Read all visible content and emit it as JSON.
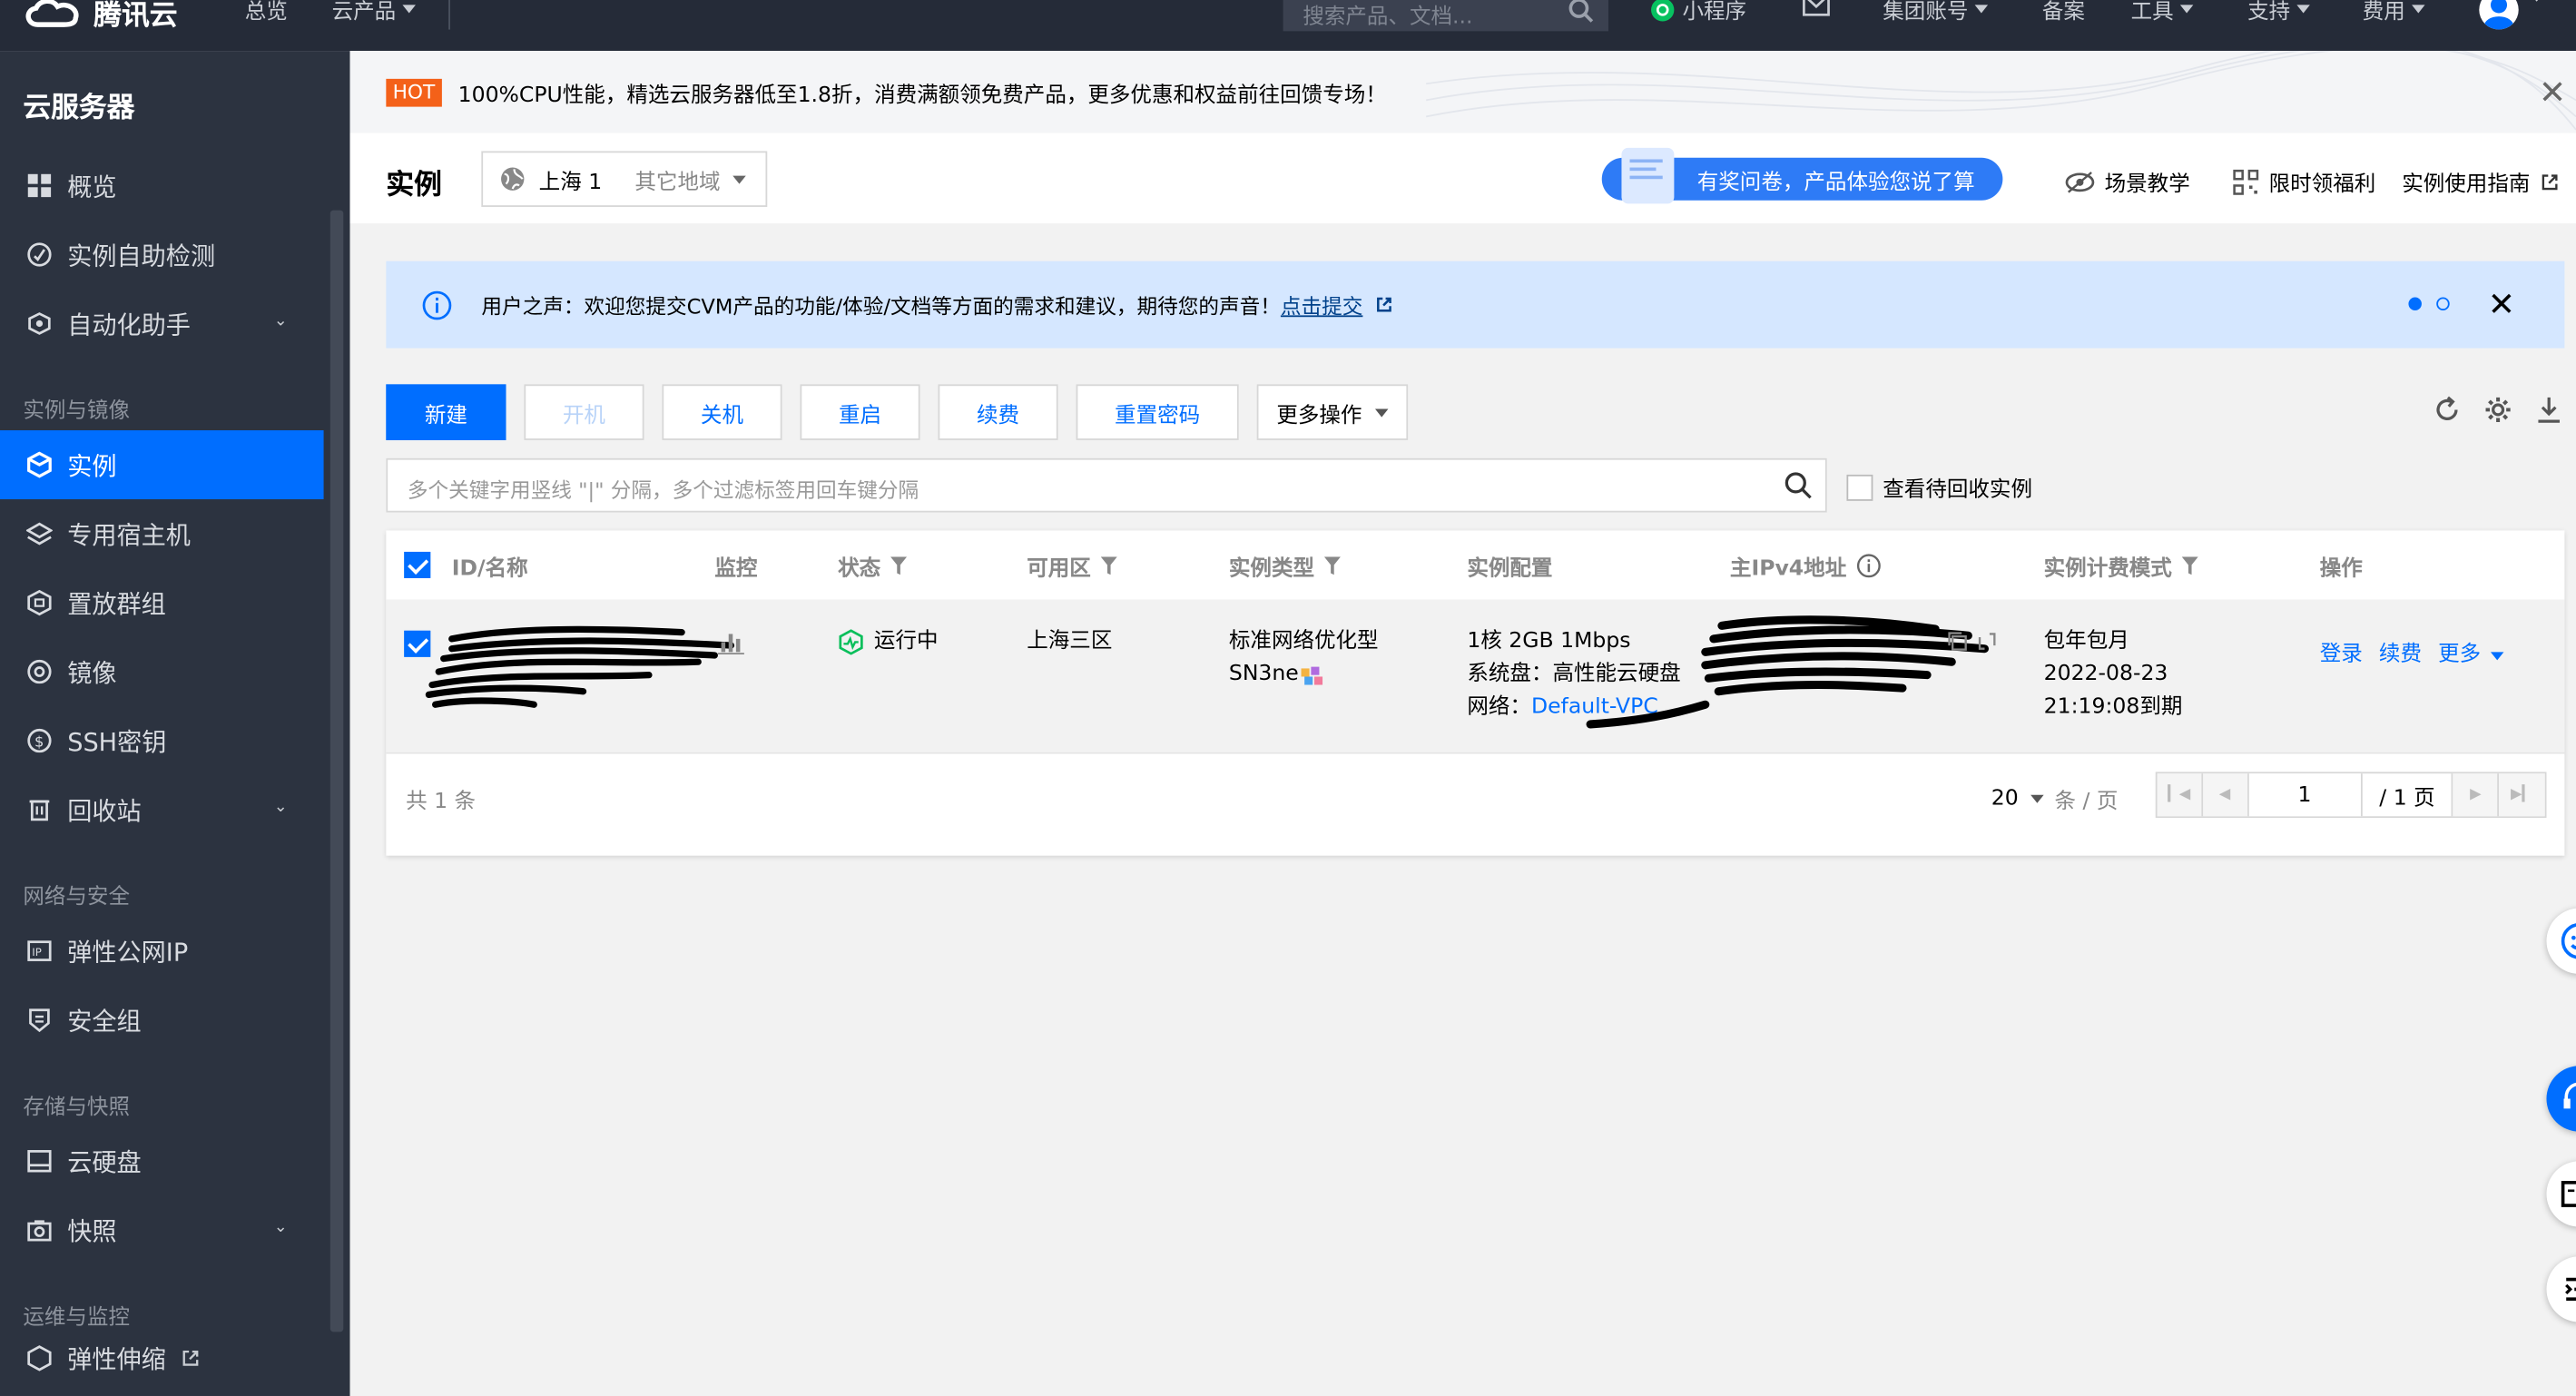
{
  "topbar": {
    "brand": "腾讯云",
    "nav": [
      "总览",
      "云产品"
    ],
    "search_placeholder": "搜索产品、文档...",
    "right": [
      "小程序",
      "集团账号",
      "备案",
      "工具",
      "支持",
      "费用"
    ]
  },
  "sidebar": {
    "title": "云服务器",
    "groups": {
      "g1": "实例与镜像",
      "g2": "网络与安全",
      "g3": "存储与快照",
      "g4": "运维与监控"
    },
    "items": [
      "概览",
      "实例自助检测",
      "自动化助手",
      "实例",
      "专用宿主机",
      "置放群组",
      "镜像",
      "SSH密钥",
      "回收站",
      "弹性公网IP",
      "安全组",
      "云硬盘",
      "快照",
      "弹性伸缩"
    ]
  },
  "promo": {
    "hot": "HOT",
    "text": "100%CPU性能，精选云服务器低至1.8折，消费满额领免费产品，更多优惠和权益前往回馈专场！"
  },
  "header": {
    "title": "实例",
    "region": "上海 1",
    "other_region": "其它地域",
    "survey": "有奖问卷，产品体验您说了算",
    "links": [
      "场景教学",
      "限时领福利",
      "实例使用指南"
    ]
  },
  "notice": {
    "text": "用户之声：欢迎您提交CVM产品的功能/体验/文档等方面的需求和建议，期待您的声音！",
    "link": "点击提交"
  },
  "toolbar": {
    "new": "新建",
    "start": "开机",
    "stop": "关机",
    "restart": "重启",
    "renew": "续费",
    "reset_pwd": "重置密码",
    "more": "更多操作"
  },
  "search": {
    "placeholder": "多个关键字用竖线 \"|\" 分隔，多个过滤标签用回车键分隔",
    "recycle": "查看待回收实例"
  },
  "table": {
    "headers": {
      "id": "ID/名称",
      "monitor": "监控",
      "status": "状态",
      "zone": "可用区",
      "type": "实例类型",
      "config": "实例配置",
      "ip": "主IPv4地址",
      "billing": "实例计费模式",
      "ops": "操作"
    },
    "row": {
      "status": "运行中",
      "zone": "上海三区",
      "type_1": "标准网络优化型",
      "type_2": "SN3ne",
      "config_1": "1核 2GB 1Mbps",
      "config_2": "系统盘：高性能云硬盘",
      "config_3_label": "网络：",
      "config_3_link": "Default-VPC",
      "billing_1": "包年包月",
      "billing_2": "2022-08-23",
      "billing_3": "21:19:08到期",
      "op_login": "登录",
      "op_renew": "续费",
      "op_more": "更多"
    }
  },
  "pager": {
    "total": "共 1 条",
    "size": "20",
    "size_unit": "条 / 页",
    "page": "1",
    "pages": "/ 1 页"
  },
  "colors": {
    "accent": "#006eff",
    "sidebar": "#2c3340",
    "topbar": "#252b38",
    "hot": "#f46119"
  }
}
